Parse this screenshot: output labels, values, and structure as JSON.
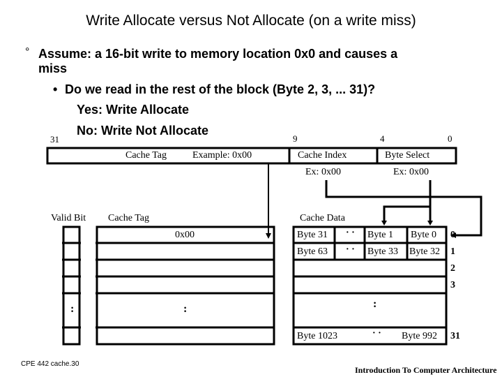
{
  "slide": {
    "title": "Write Allocate versus Not Allocate (on a write miss)",
    "bullet_marker": "°",
    "bullet1": "Assume: a 16-bit write to memory location 0x0 and causes a",
    "bullet1_cont": "miss",
    "sub_marker": "•",
    "sub_bullet": "Do we read in the rest of the block (Byte 2, 3, ... 31)?",
    "yes_line": "Yes: Write Allocate",
    "no_line": "No: Write Not Allocate"
  },
  "address": {
    "bit_labels": [
      "31",
      "9",
      "4",
      "0"
    ],
    "fields": {
      "tag": "Cache Tag",
      "tag_example": "Example: 0x00",
      "index": "Cache Index",
      "index_example": "Ex: 0x00",
      "byte_select": "Byte Select",
      "byte_select_example": "Ex: 0x00"
    }
  },
  "cache": {
    "valid_bit_label": "Valid Bit",
    "tag_label": "Cache Tag",
    "data_label": "Cache Data",
    "tag_row0": "0x00",
    "ellipsis": ":",
    "dots": "· ·",
    "rows": [
      {
        "index": "0",
        "cells": [
          "Byte 31",
          "Byte 1",
          "Byte 0"
        ]
      },
      {
        "index": "1",
        "cells": [
          "Byte 63",
          "Byte 33",
          "Byte 32"
        ]
      },
      {
        "index": "2",
        "cells": []
      },
      {
        "index": "3",
        "cells": []
      },
      {
        "index": "31",
        "cells": [
          "Byte 1023",
          "Byte 992"
        ]
      }
    ]
  },
  "footer": {
    "left": "CPE 442  cache.30",
    "right": "Introduction To Computer Architecture"
  }
}
